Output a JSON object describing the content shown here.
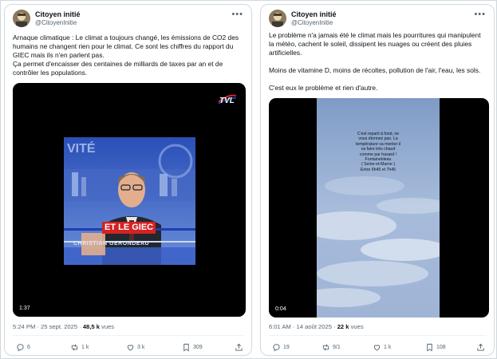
{
  "tweets": [
    {
      "user": {
        "name": "Citoyen initié",
        "handle": "@CitoyenInitie"
      },
      "text": [
        "Arnaque climatique : Le climat a toujours changé, les émissions de CO2 des humains ne changent rien pour le climat. Ce sont les chiffres du rapport du GIEC mais ils n'en parlent pas.",
        "Ça permet d'encaisser des centaines de milliards de taxes par an et de contrôler les populations."
      ],
      "video": {
        "duration": "1:37",
        "channel_logo": "TVL",
        "banner_text": "ET LE GIEC",
        "lower_third": "CHRISTIAN GERONDEAU",
        "bg_text": "VITÉ"
      },
      "time": "5:24 PM · 25 sept. 2025 · ",
      "views_count": "48,5 k",
      "views_label": " vues",
      "actions": {
        "replies": "6",
        "reposts": "1 k",
        "likes": "3 k",
        "bookmarks": "309"
      }
    },
    {
      "user": {
        "name": "Citoyen initié",
        "handle": "@CitoyenInitie"
      },
      "text": [
        "Le problème n'a jamais été le climat mais les pourritures qui manipulent la météo, cachent le soleil, dissipent les nuages ou créent des pluies artificielles.",
        "Moins de vitamine D, moins de récoltes, pollution de l'air, l'eau, les sols.",
        "C'est eux le problème et rien d'autre."
      ],
      "video": {
        "duration": "0:04",
        "overlay_lines": [
          "C'est reparti à fond, ne",
          "vous étonnez pas. La",
          "température va monter il",
          "va faire très chaud",
          "comme par hasard !",
          "Fontainebleau",
          "( Seine-et-Marne )",
          "Entre 6h45 et 7h45"
        ]
      },
      "time": "6:01 AM · 14 août 2025 · ",
      "views_count": "22 k",
      "views_label": " vues",
      "actions": {
        "replies": "19",
        "reposts": "9/1",
        "likes": "1 k",
        "bookmarks": "108"
      }
    }
  ],
  "colors": {
    "text": "#0f1419",
    "muted": "#536471",
    "border": "#cfd9de",
    "tvl_blue": "#1c3fb0",
    "banner_red": "#d42323"
  },
  "icons": [
    "reply-icon",
    "repost-icon",
    "like-icon",
    "bookmark-icon",
    "share-icon",
    "more-icon"
  ]
}
